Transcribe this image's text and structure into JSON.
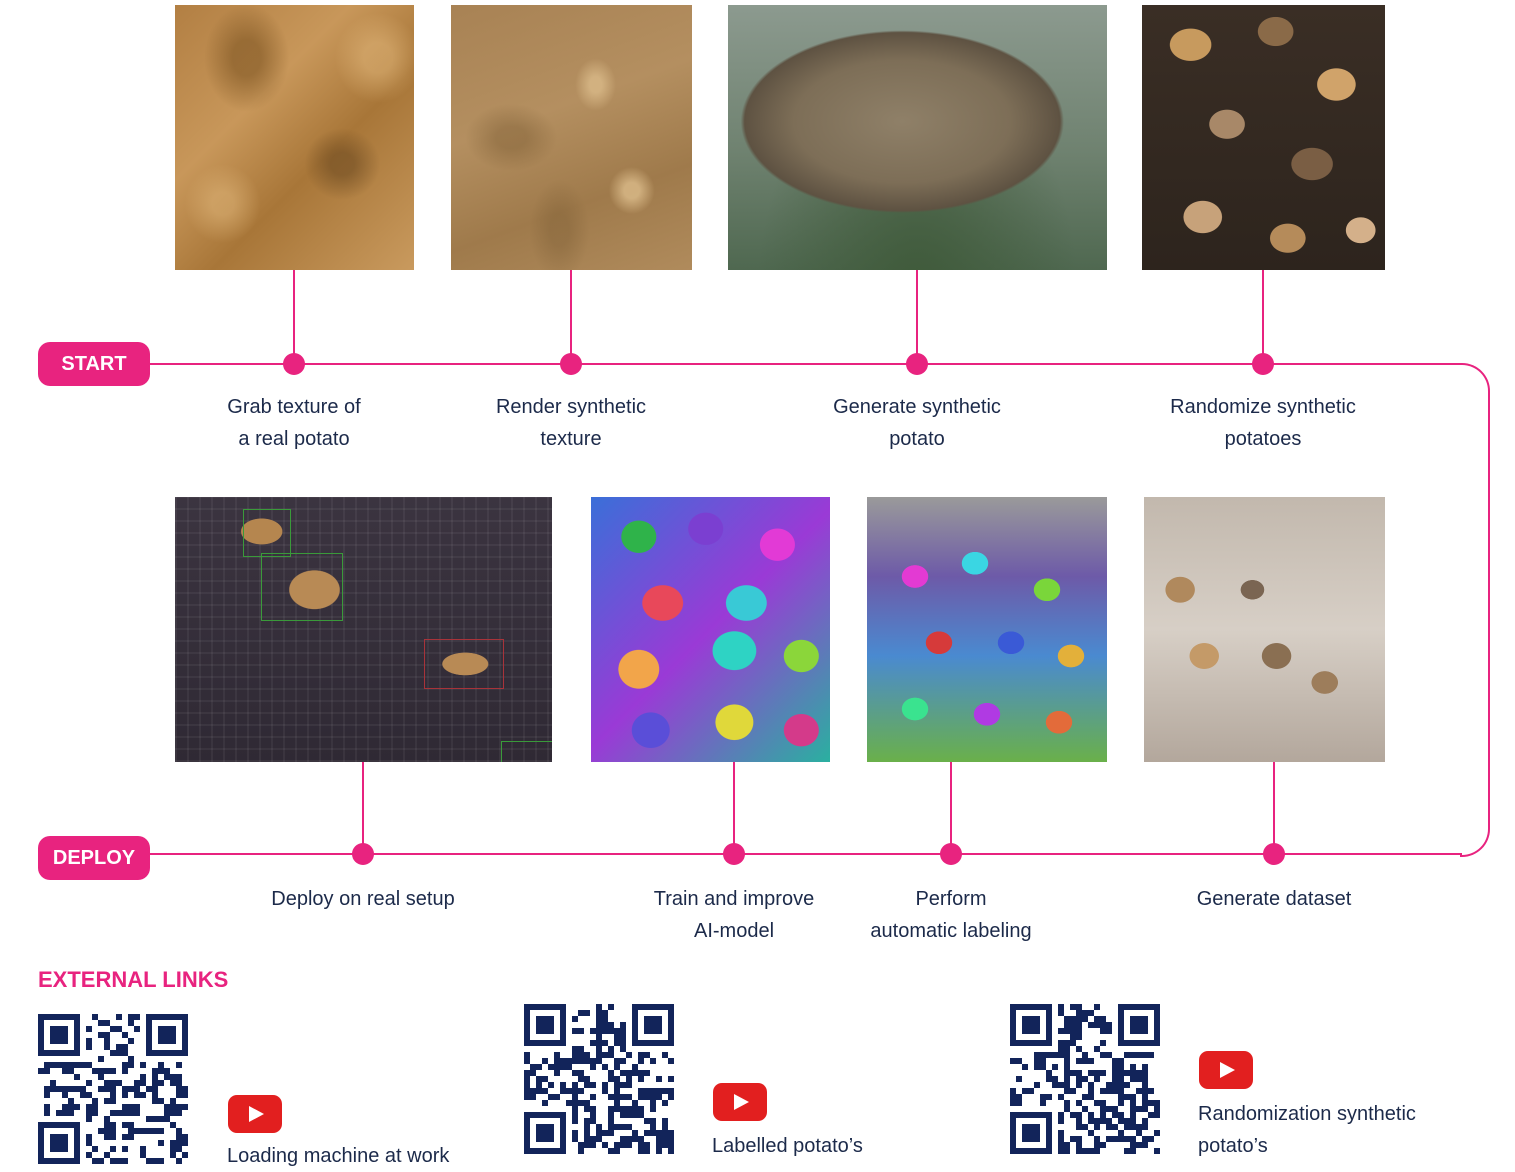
{
  "colors": {
    "accent": "#e8237f",
    "text": "#1c2a4a",
    "qr": "#12245a",
    "youtube": "#e21f1f"
  },
  "pills": {
    "start": "START",
    "deploy": "DEPLOY"
  },
  "steps_top": [
    {
      "line1": "Grab texture of",
      "line2": "a real potato",
      "image": "real-potato-texture"
    },
    {
      "line1": "Render synthetic",
      "line2": "texture",
      "image": "synthetic-texture"
    },
    {
      "line1": "Generate synthetic",
      "line2": "potato",
      "image": "synthetic-potato"
    },
    {
      "line1": "Randomize synthetic",
      "line2": "potatoes",
      "image": "randomized-potatoes"
    }
  ],
  "steps_bottom": [
    {
      "line1": "Deploy on real setup",
      "line2": "",
      "image": "real-setup-detection"
    },
    {
      "line1": "Train and improve",
      "line2": "AI-model",
      "image": "segmented-potatoes"
    },
    {
      "line1": "Perform",
      "line2": "automatic labeling",
      "image": "auto-labeled-potatoes"
    },
    {
      "line1": "Generate dataset",
      "line2": "",
      "image": "dataset-render"
    }
  ],
  "external": {
    "heading": "EXTERNAL LINKS",
    "links": [
      {
        "line1": "Loading machine at work",
        "line2": "",
        "icon": "youtube-icon"
      },
      {
        "line1": "Labelled potato’s",
        "line2": "",
        "icon": "youtube-icon"
      },
      {
        "line1": "Randomization synthetic",
        "line2": "potato’s",
        "icon": "youtube-icon"
      }
    ]
  }
}
